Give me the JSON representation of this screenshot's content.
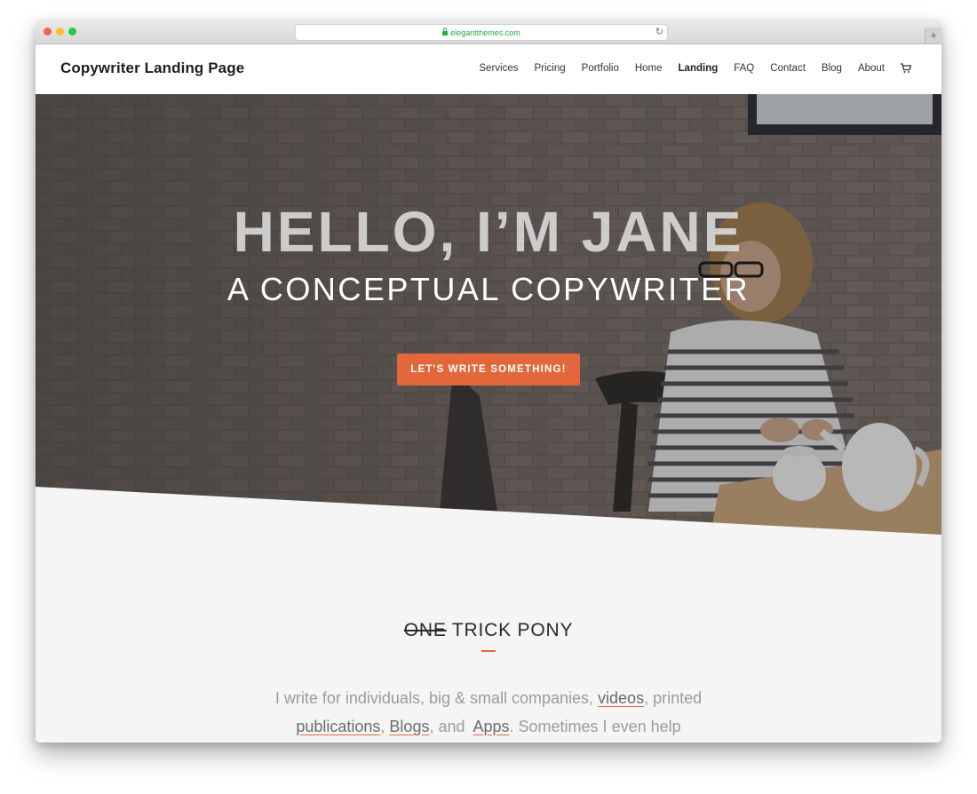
{
  "browser": {
    "url": "elegantthemes.com"
  },
  "site": {
    "logo": "Copywriter Landing Page"
  },
  "nav": {
    "items": [
      {
        "label": "Services"
      },
      {
        "label": "Pricing"
      },
      {
        "label": "Portfolio"
      },
      {
        "label": "Home"
      },
      {
        "label": "Landing"
      },
      {
        "label": "FAQ"
      },
      {
        "label": "Contact"
      },
      {
        "label": "Blog"
      },
      {
        "label": "About"
      }
    ],
    "cart_icon": "cart-icon"
  },
  "hero": {
    "title": "HELLO, I’M JANE",
    "subtitle": "A CONCEPTUAL COPYWRITER",
    "cta": "LET'S WRITE SOMETHING!"
  },
  "section": {
    "title_struck": "ONE",
    "title_rest": " TRICK PONY",
    "text_1": "I write for individuals, big & small companies, ",
    "link_videos": "videos",
    "text_2": ", printed ",
    "link_publications": "publications",
    "text_3": ", ",
    "link_blogs": "Blogs",
    "text_4": ", and  ",
    "link_apps": "Apps",
    "text_5": ". Sometimes I even help"
  },
  "colors": {
    "accent": "#e3673b",
    "body_text": "#9b9b9b"
  }
}
